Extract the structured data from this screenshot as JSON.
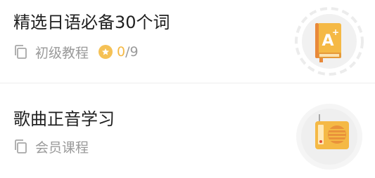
{
  "courses": [
    {
      "title": "精选日语必备30个词",
      "type_label": "初级教程",
      "progress_done": "0",
      "progress_total": "/9"
    },
    {
      "title": "歌曲正音学习",
      "type_label": "会员课程"
    }
  ],
  "icons": {
    "copy": "copy-icon",
    "star": "star-icon",
    "book": "book-icon",
    "radio": "radio-icon"
  },
  "colors": {
    "accent": "#f5b945",
    "icon_bg": "#f0f0f0",
    "text_primary": "#1f1f1f",
    "text_secondary": "#9a9a9a"
  }
}
